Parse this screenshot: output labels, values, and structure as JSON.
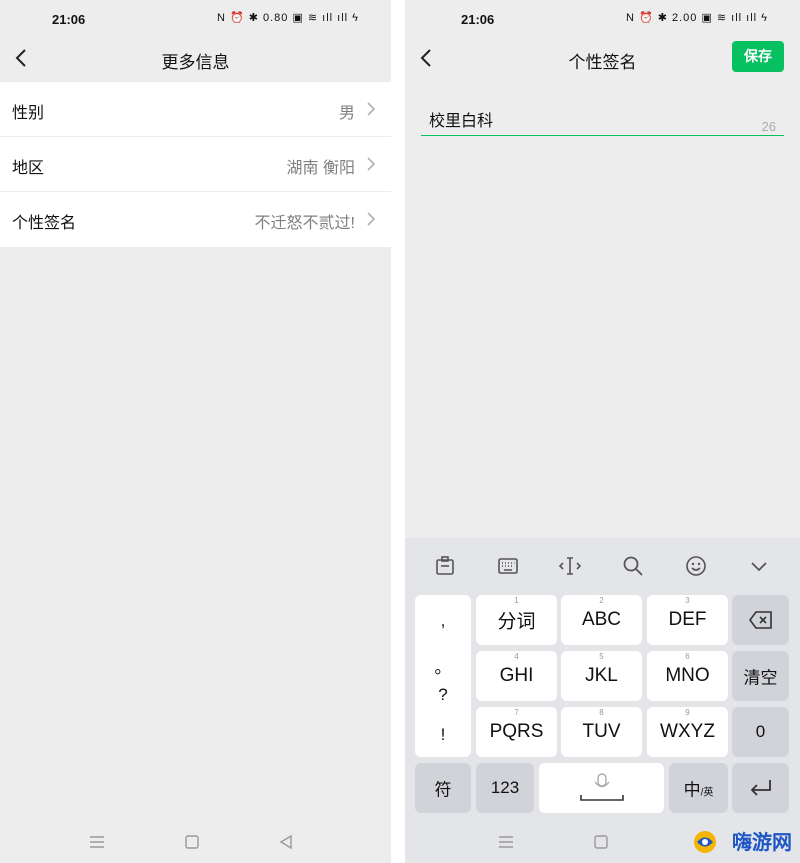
{
  "left": {
    "status": {
      "time": "21:06",
      "icons_text": "N ⏰ ✱ 0.80 ▣ ≋ ıll ıll ϟ"
    },
    "title": "更多信息",
    "rows": [
      {
        "label": "性别",
        "value": "男"
      },
      {
        "label": "地区",
        "value": "湖南 衡阳"
      },
      {
        "label": "个性签名",
        "value": "不迁怒不贰过!"
      }
    ]
  },
  "right": {
    "status": {
      "time": "21:06",
      "icons_text": "N ⏰ ✱ 2.00 ▣ ≋ ıll ıll ϟ"
    },
    "title": "个性签名",
    "save_label": "保存",
    "input_value": "校里白科",
    "char_count": "26"
  },
  "keyboard": {
    "punct": [
      ",",
      "。",
      "?",
      "!"
    ],
    "keys": [
      {
        "num": "1",
        "label": "分词"
      },
      {
        "num": "2",
        "label": "ABC"
      },
      {
        "num": "3",
        "label": "DEF"
      },
      {
        "num": "4",
        "label": "GHI"
      },
      {
        "num": "5",
        "label": "JKL"
      },
      {
        "num": "6",
        "label": "MNO"
      },
      {
        "num": "7",
        "label": "PQRS"
      },
      {
        "num": "8",
        "label": "TUV"
      },
      {
        "num": "9",
        "label": "WXYZ"
      }
    ],
    "clear_label": "清空",
    "zero_label": "0",
    "symbol_label": "符",
    "num_label": "123",
    "lang_label": "中",
    "lang_sub": "/英"
  },
  "watermark": "嗨游网"
}
